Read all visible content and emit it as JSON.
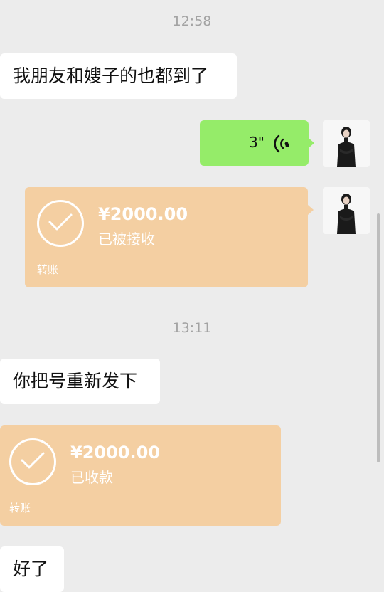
{
  "messages": {
    "time1": "12:58",
    "msg1": "我朋友和嫂子的也都到了",
    "voice_duration": "3\"",
    "transfer1": {
      "amount": "¥2000.00",
      "status": "已被接收",
      "footer": "转账"
    },
    "time2": "13:11",
    "msg2": "你把号重新发下",
    "transfer2": {
      "amount": "¥2000.00",
      "status": "已收款",
      "footer": "转账"
    },
    "msg3": "好了"
  },
  "colors": {
    "background": "#ececec",
    "voice_bubble": "#95ec69",
    "transfer_bubble": "#f4cfa2",
    "text_bubble": "#ffffff"
  },
  "icons": {
    "voice": "voice-wave-icon",
    "transfer_check": "check-circle-icon",
    "avatar": "avatar-icon"
  }
}
